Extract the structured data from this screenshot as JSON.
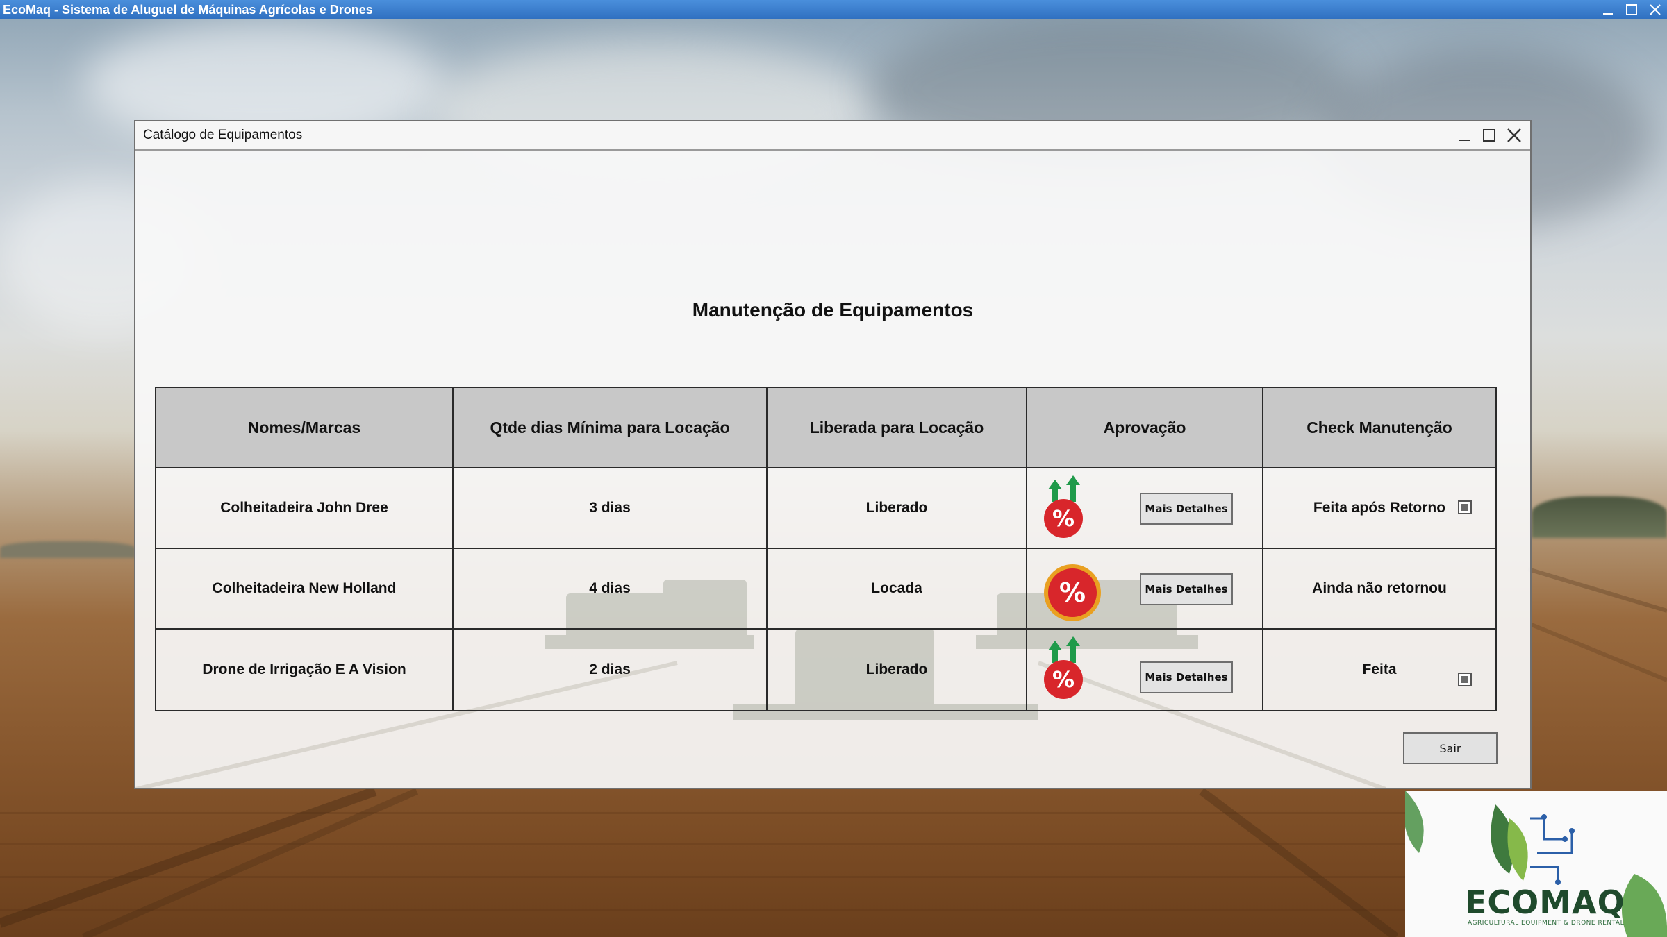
{
  "app": {
    "title": "EcoMaq - Sistema de Aluguel de Máquinas Agrícolas e Drones",
    "window_controls": [
      "minimize-icon",
      "maximize-icon",
      "close-icon"
    ]
  },
  "catalog_window": {
    "title": "Catálogo de Equipamentos",
    "window_controls": [
      "minimize-icon",
      "maximize-icon",
      "close-icon"
    ]
  },
  "page": {
    "heading": "Manutenção de Equipamentos"
  },
  "table": {
    "headers": [
      "Nomes/Marcas",
      "Qtde dias Mínima para Locação",
      "Liberada para Locação",
      "Aprovação",
      "Check Manutenção"
    ],
    "rows": [
      {
        "name": "Colheitadeira John Dree",
        "min_days": "3 dias",
        "status": "Liberado",
        "approval_icon": "percent-growth-icon",
        "details_label": "Mais Detalhes",
        "maintenance_text": "Feita após Retorno",
        "maintenance_checked": true
      },
      {
        "name": "Colheitadeira New Holland",
        "min_days": "4 dias",
        "status": "Locada",
        "approval_icon": "percent-badge-icon",
        "details_label": "Mais Detalhes",
        "maintenance_text": "Ainda não retornou",
        "maintenance_checked": false
      },
      {
        "name": "Drone de Irrigação E A Vision",
        "min_days": "2 dias",
        "status": "Liberado",
        "approval_icon": "percent-growth-icon",
        "details_label": "Mais Detalhes",
        "maintenance_text": "Feita",
        "maintenance_checked": true
      }
    ]
  },
  "actions": {
    "exit_label": "Sair"
  },
  "logo": {
    "name": "ECOMAQ",
    "tagline": "AGRICULTURAL EQUIPMENT & DRONE RENTAL"
  },
  "colors": {
    "titlebar": "#2f6fc0",
    "header_bg": "#c8c8c8",
    "badge_red": "#d8262b",
    "arrow_green": "#1f9a4a",
    "logo_green": "#1f4a2c"
  }
}
